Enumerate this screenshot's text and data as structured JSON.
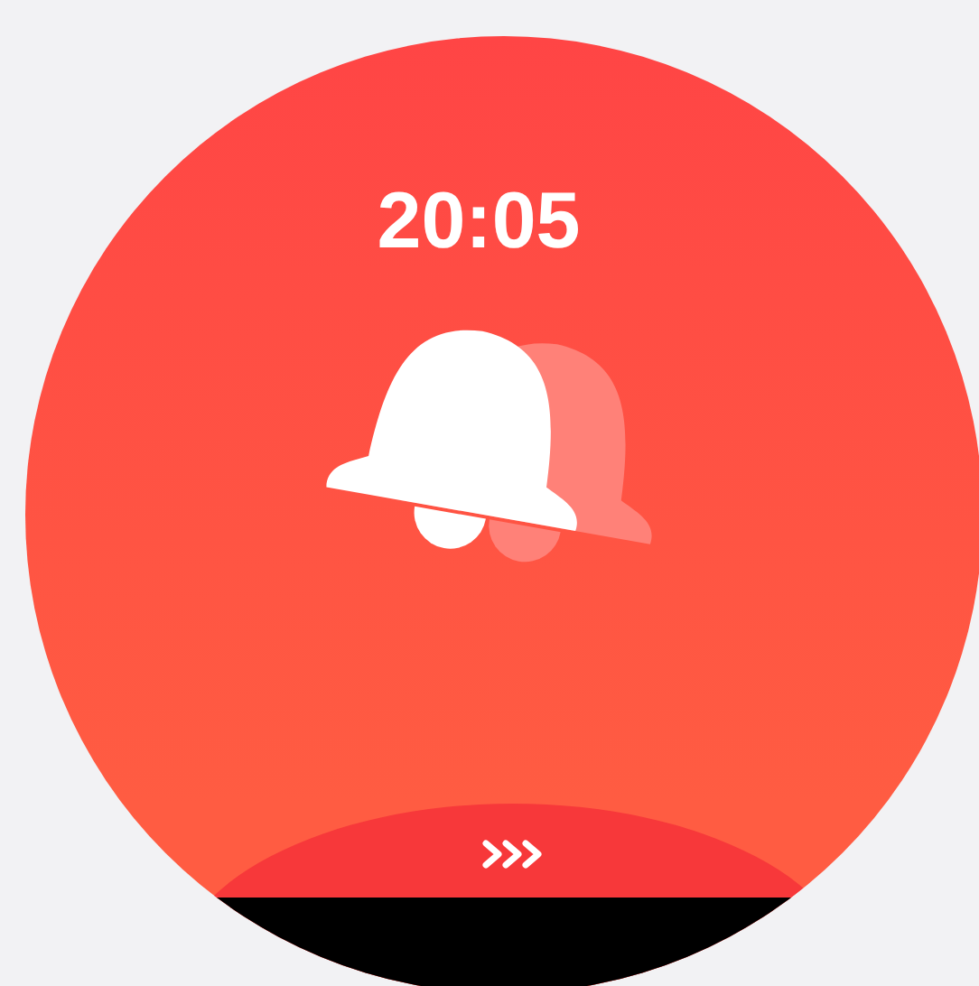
{
  "alarm": {
    "time": "20:05"
  }
}
